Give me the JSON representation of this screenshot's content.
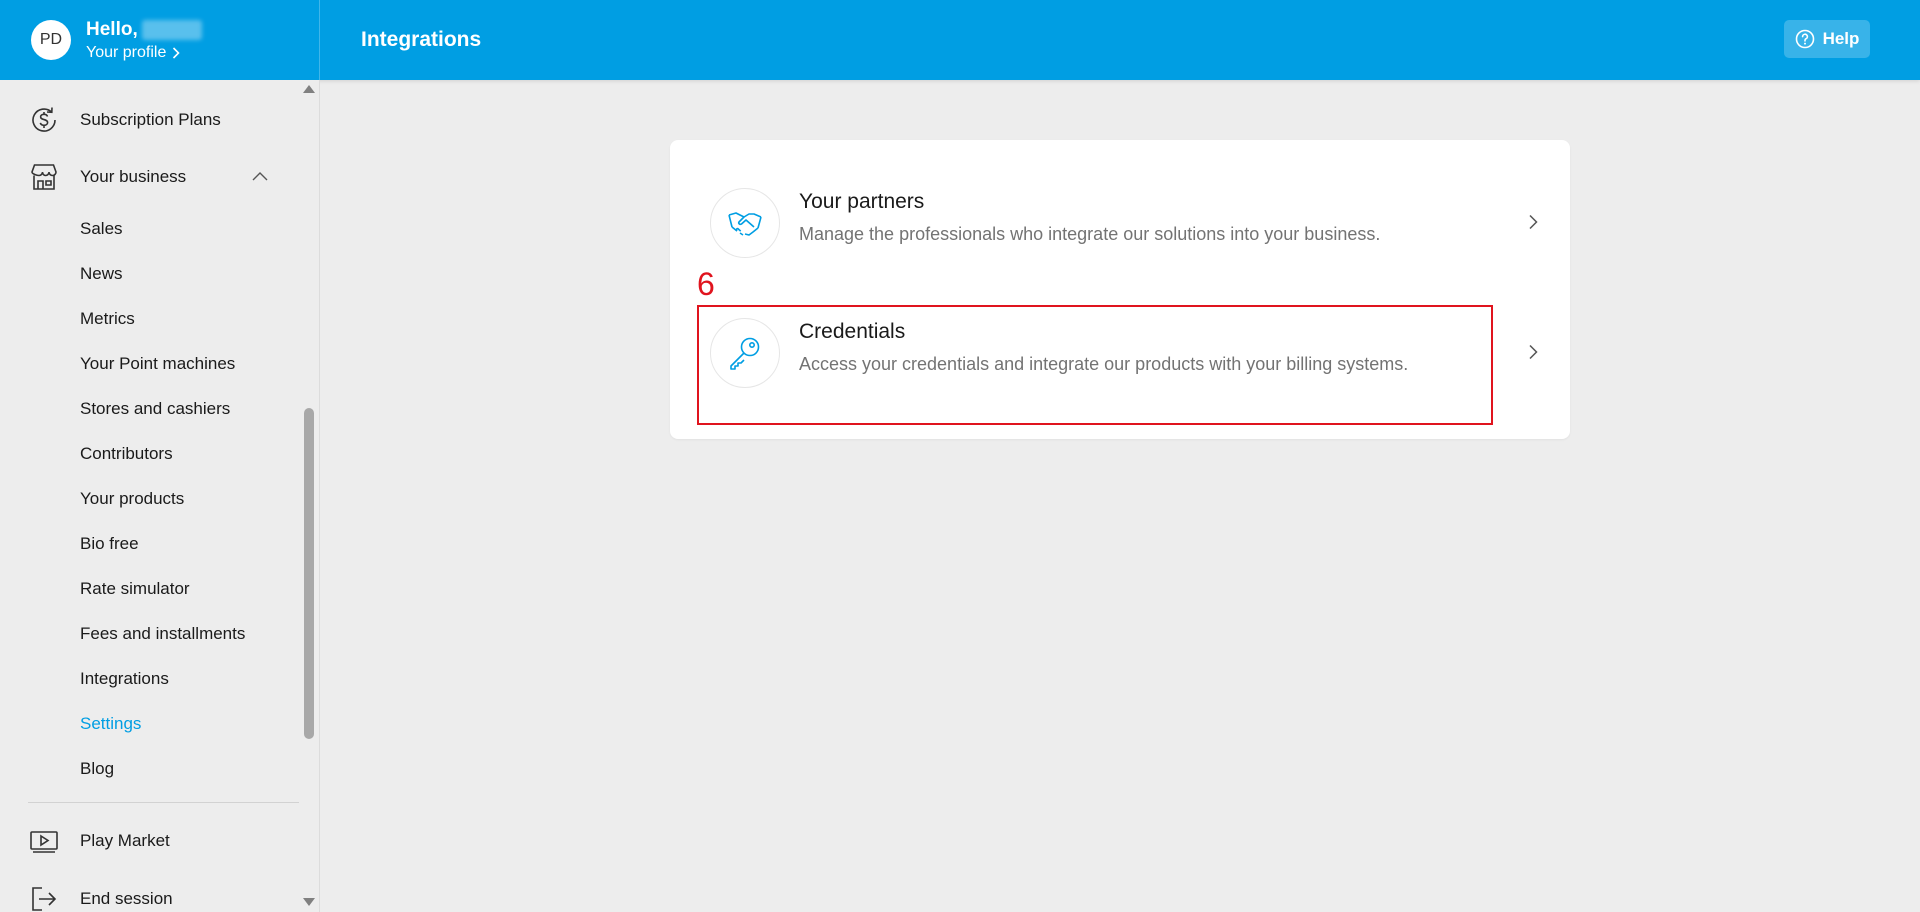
{
  "header": {
    "avatar_initials": "PD",
    "greeting": "Hello,",
    "profile_link": "Your profile",
    "page_title": "Integrations",
    "help_label": "Help",
    "brand_color": "#009ee3"
  },
  "sidebar": {
    "main_items": [
      {
        "label": "Subscription Plans",
        "icon": "dollar-refresh-icon"
      },
      {
        "label": "Your business",
        "icon": "store-icon",
        "expanded": true
      }
    ],
    "sub_items": [
      {
        "label": "Sales"
      },
      {
        "label": "News"
      },
      {
        "label": "Metrics"
      },
      {
        "label": "Your Point machines"
      },
      {
        "label": "Stores and cashiers"
      },
      {
        "label": "Contributors"
      },
      {
        "label": "Your products"
      },
      {
        "label": "Bio free"
      },
      {
        "label": "Rate simulator"
      },
      {
        "label": "Fees and installments"
      },
      {
        "label": "Integrations"
      },
      {
        "label": "Settings",
        "active": true
      },
      {
        "label": "Blog"
      }
    ],
    "footer_items": [
      {
        "label": "Play Market",
        "icon": "play-icon"
      },
      {
        "label": "End session",
        "icon": "logout-icon"
      }
    ]
  },
  "integrations": [
    {
      "title": "Your partners",
      "description": "Manage the professionals who integrate our solutions into your business.",
      "icon": "handshake-icon"
    },
    {
      "title": "Credentials",
      "description": "Access your credentials and integrate our products with your billing systems.",
      "icon": "key-icon"
    }
  ],
  "annotation": {
    "label": "6",
    "color": "#e0141e"
  }
}
